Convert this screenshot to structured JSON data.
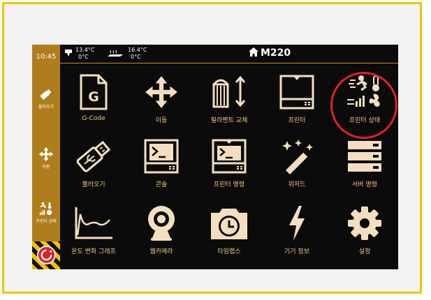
{
  "status": {
    "time": "10:45"
  },
  "temps": {
    "nozzle": {
      "current": "13.4°C",
      "target": "0°C"
    },
    "bed": {
      "current": "16.4°C",
      "target": "0°C"
    }
  },
  "header": {
    "title": "M220",
    "home_icon": "home-icon"
  },
  "sidebar": {
    "items": [
      {
        "label": "불러오기",
        "icon": "usb-icon"
      },
      {
        "label": "이동",
        "icon": "move-icon"
      },
      {
        "label": "프린터 상태",
        "icon": "printer-status-icon"
      }
    ],
    "estop_icon": "emergency-stop-icon"
  },
  "tiles": [
    {
      "label": "G-Code",
      "icon": "gcode-file-icon"
    },
    {
      "label": "이동",
      "icon": "move-icon"
    },
    {
      "label": "필라멘트 교체",
      "icon": "filament-icon"
    },
    {
      "label": "프린터",
      "icon": "printer-icon"
    },
    {
      "label": "프린터 상태",
      "icon": "printer-status-icon"
    },
    {
      "label": "불러오기",
      "icon": "usb-icon"
    },
    {
      "label": "콘솔",
      "icon": "console-icon"
    },
    {
      "label": "프린터 명령",
      "icon": "printer-command-icon"
    },
    {
      "label": "위저드",
      "icon": "wizard-icon"
    },
    {
      "label": "서버 명령",
      "icon": "server-icon"
    },
    {
      "label": "온도 변화 그래프",
      "icon": "temperature-graph-icon"
    },
    {
      "label": "웹카메라",
      "icon": "webcam-icon"
    },
    {
      "label": "타임랩스",
      "icon": "timelapse-icon"
    },
    {
      "label": "기기 정보",
      "icon": "lightning-icon"
    },
    {
      "label": "설정",
      "icon": "gear-icon"
    }
  ],
  "colors": {
    "sidebar": "#b07d1d",
    "icon": "#f3dfbf",
    "label": "#f0c78a",
    "frame": "#f2c200",
    "highlight": "#e0202a"
  }
}
